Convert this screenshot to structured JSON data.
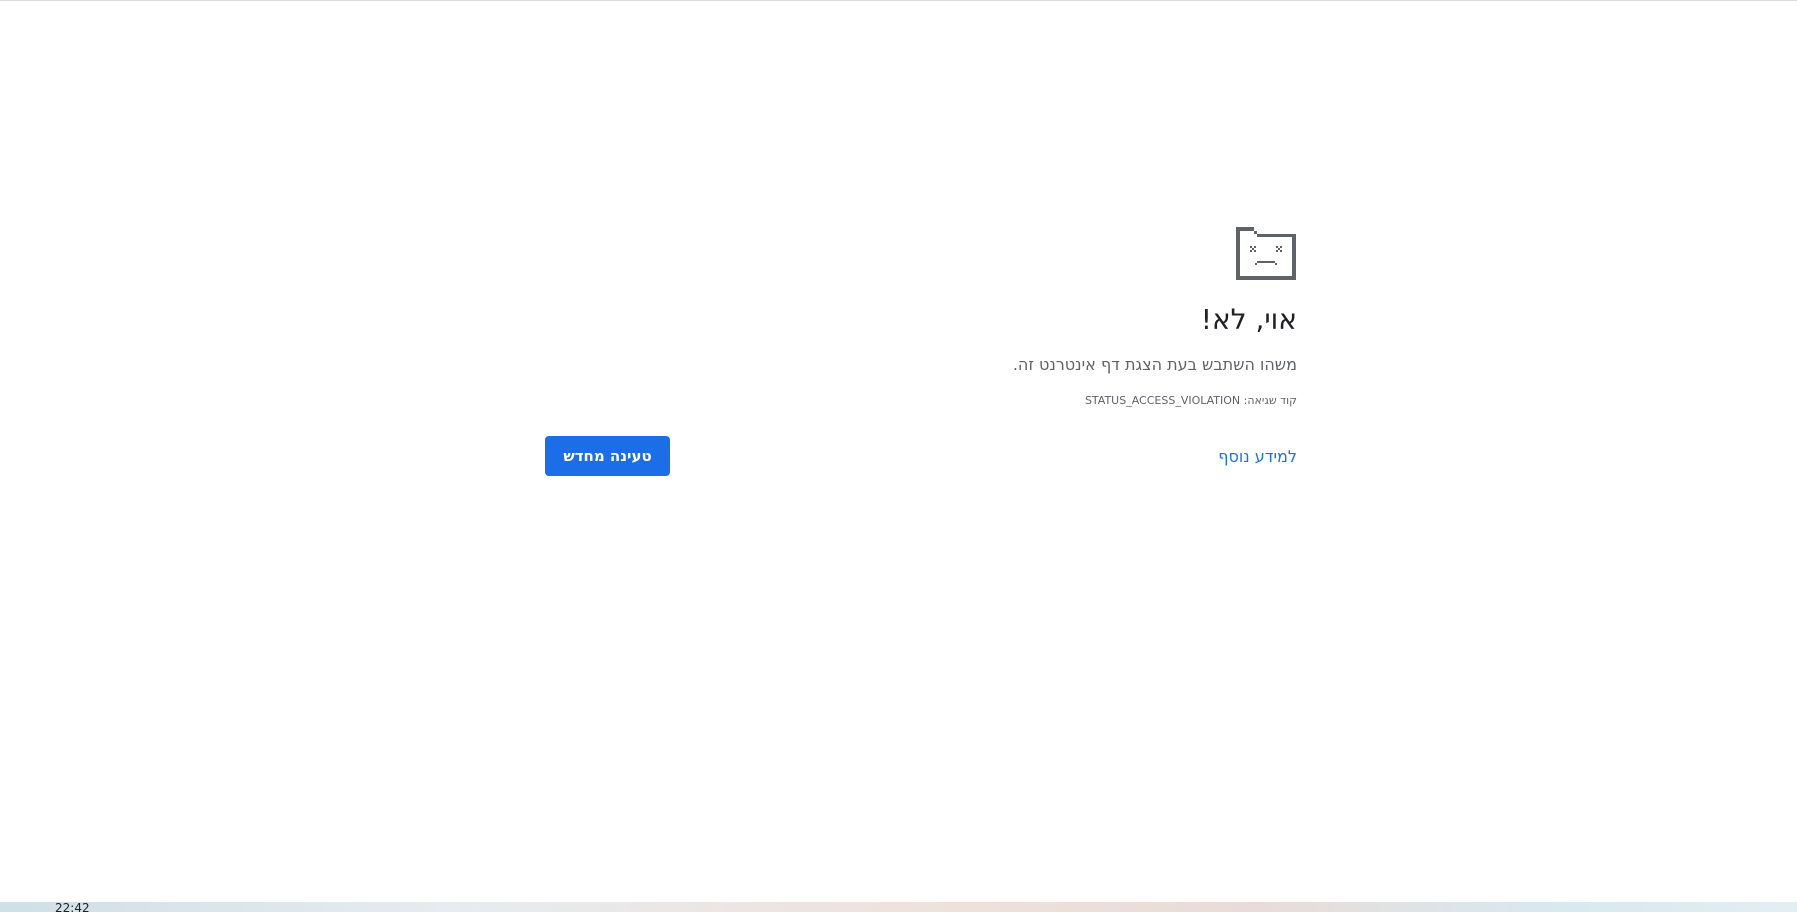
{
  "error_page": {
    "icon": "sad-tab-icon",
    "heading": "אוי, לא!",
    "message": "משהו השתבש בעת הצגת דף אינטרנט זה.",
    "error_code": "קוד שגיאה: STATUS_ACCESS_VIOLATION",
    "learn_more_label": "למידע נוסף",
    "reload_label": "טעינה מחדש"
  },
  "taskbar": {
    "clock": "22:42"
  },
  "colors": {
    "accent": "#1a73e8",
    "button": "#1b6ee8",
    "heading": "#202124",
    "secondary_text": "#5f6368",
    "icon": "#5f6368"
  }
}
